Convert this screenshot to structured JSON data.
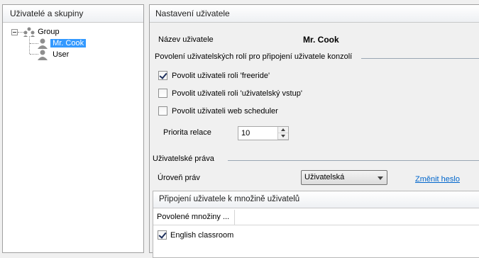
{
  "left_panel": {
    "title": "Uživatelé a skupiny",
    "tree": {
      "group_label": "Group",
      "users": [
        "Mr. Cook",
        "User"
      ]
    }
  },
  "right_panel": {
    "title": "Nastavení uživatele",
    "user_name_label": "Název uživatele",
    "user_name_value": "Mr. Cook",
    "roles_section": "Povolení uživatelských rolí pro připojení uživatele konzolí",
    "checkboxes": [
      {
        "label": "Povolit uživateli roli 'freeride'",
        "checked": true
      },
      {
        "label": "Povolit uživateli roli 'uživatelský vstup'",
        "checked": false
      },
      {
        "label": "Povolit uživateli web scheduler",
        "checked": false
      }
    ],
    "priority_label": "Priorita relace",
    "priority_value": "10",
    "rights_section": "Uživatelské práva",
    "rights_level_label": "Úroveň práv",
    "rights_level_value": "Uživatelská",
    "change_password_link": "Změnit heslo",
    "sets_panel": {
      "title": "Připojení uživatele k množině uživatelů",
      "column_header": "Povolené množiny ...",
      "rows": [
        {
          "label": "English classroom",
          "checked": true
        }
      ]
    }
  }
}
